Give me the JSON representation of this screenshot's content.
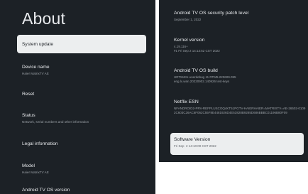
{
  "left": {
    "title": "About",
    "items": [
      {
        "label": "System update",
        "sub": ""
      },
      {
        "label": "Device name",
        "sub": "Haier MatrixTV AE"
      },
      {
        "label": "Reset",
        "sub": ""
      },
      {
        "label": "Status",
        "sub": "Network, serial numbers and other information"
      },
      {
        "label": "Legal information",
        "sub": ""
      },
      {
        "label": "Model",
        "sub": "Haier MatrixTV AE"
      },
      {
        "label": "Android TV OS version",
        "sub": ""
      }
    ]
  },
  "right": {
    "items": [
      {
        "title": "Android TV OS security patch level",
        "value": "September 1, 2022"
      },
      {
        "title": "Kernel version",
        "value": "4.19.116+\n#1 Fri Sep 2 14:13:52 CST 2022"
      },
      {
        "title": "Android TV OS build",
        "value": "HRT51EU-userdebug 11 RTM5.220609.095\neng.lx.wan.20220902.140926 test-keys"
      },
      {
        "title": "Netflix ESN",
        "value": "NFANDROID2-PRV-REFPLUSCOQ4KT51PGTV-HAIERHAIER=MATRIXTV=AE-26502-01092C603C26AC6F062C55F8E4481926D4E53828B9285D686BBBC01196B80F09"
      },
      {
        "title": "Software Version",
        "value": "Fri Sep  2 14:10:00 CST 2022"
      }
    ]
  }
}
